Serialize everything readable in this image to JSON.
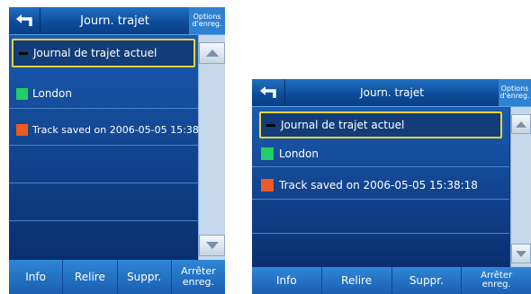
{
  "title": "Journ. trajet",
  "options_label": [
    "Options",
    "d'enreg."
  ],
  "tracks": [
    {
      "label": "Journal de trajet actuel",
      "color": "#000000",
      "selected": true
    },
    {
      "label": "London",
      "color": "#22cc66",
      "selected": false
    },
    {
      "label": "Track saved on 2006-05-05 15:38:18",
      "color": "#ee5a24",
      "selected": false
    }
  ],
  "buttons": {
    "info": "Info",
    "relire": "Relire",
    "suppr": "Suppr.",
    "arreter": [
      "Arrêter",
      "enreg."
    ]
  },
  "colors": {
    "accent": "#f0d23a",
    "panel": "#0d3f86",
    "toolbar": "#2f86d6"
  },
  "icons": {
    "back": "back-arrow-icon",
    "up": "scroll-up-icon",
    "down": "scroll-down-icon"
  }
}
